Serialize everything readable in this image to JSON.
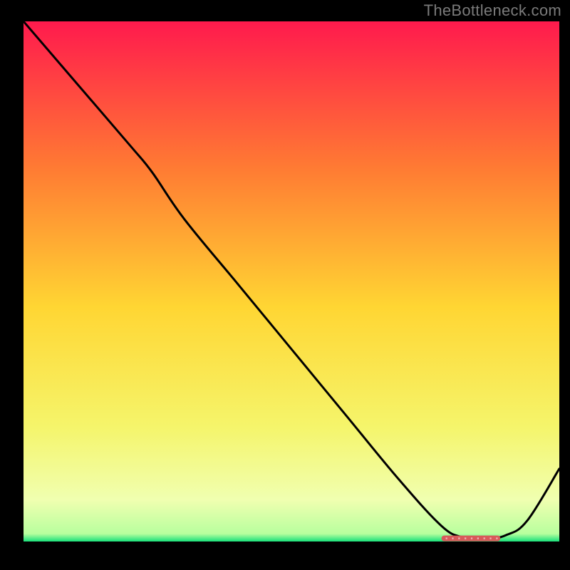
{
  "watermark": "TheBottleneck.com",
  "colors": {
    "bg": "#000000",
    "grad_top": "#ff1a4d",
    "grad_mid_upper": "#ff7a33",
    "grad_mid": "#ffd633",
    "grad_mid_lower": "#f5f56b",
    "grad_lower": "#f0ffb0",
    "grad_bottom": "#18e07a",
    "line": "#000000",
    "marker": "#d85a5a",
    "marker_text": "#ffffff"
  },
  "chart_data": {
    "type": "line",
    "title": "",
    "xlabel": "",
    "ylabel": "",
    "xlim": [
      0,
      100
    ],
    "ylim": [
      0,
      100
    ],
    "grid": false,
    "legend": false,
    "annotations": [],
    "series": [
      {
        "name": "curve",
        "x": [
          0,
          10,
          20,
          24,
          30,
          40,
          50,
          60,
          70,
          78,
          82,
          86,
          90,
          94,
          100
        ],
        "y": [
          100,
          88,
          76,
          71,
          62,
          49.5,
          37,
          24.5,
          12,
          3,
          0.8,
          0.4,
          1.2,
          4,
          14
        ]
      }
    ],
    "marker": {
      "x_start": 78,
      "x_end": 89,
      "y": 0.6,
      "label": ""
    }
  }
}
